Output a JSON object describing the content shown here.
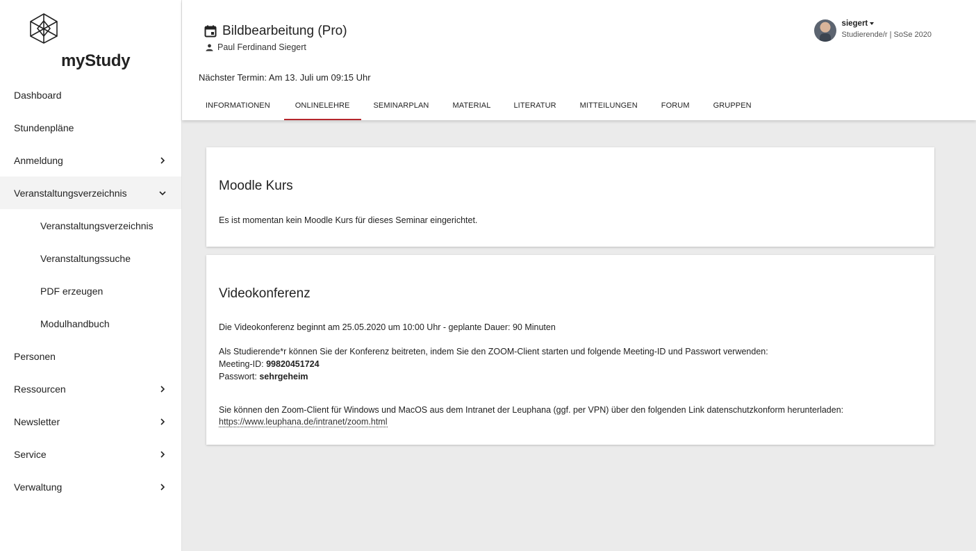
{
  "logo": {
    "text": "myStudy"
  },
  "sidebar": {
    "items": [
      {
        "label": "Dashboard",
        "chevron": ""
      },
      {
        "label": "Stundenpläne",
        "chevron": ""
      },
      {
        "label": "Anmeldung",
        "chevron": "right"
      },
      {
        "label": "Veranstaltungsverzeichnis",
        "chevron": "down"
      },
      {
        "label": "Veranstaltungsverzeichnis",
        "chevron": "",
        "sub": true
      },
      {
        "label": "Veranstaltungssuche",
        "chevron": "",
        "sub": true
      },
      {
        "label": "PDF erzeugen",
        "chevron": "",
        "sub": true
      },
      {
        "label": "Modulhandbuch",
        "chevron": "",
        "sub": true
      },
      {
        "label": "Personen",
        "chevron": ""
      },
      {
        "label": "Ressourcen",
        "chevron": "right"
      },
      {
        "label": "Newsletter",
        "chevron": "right"
      },
      {
        "label": "Service",
        "chevron": "right"
      },
      {
        "label": "Verwaltung",
        "chevron": "right"
      }
    ]
  },
  "header": {
    "title": "Bildbearbeitung (Pro)",
    "lecturer": "Paul Ferdinand Siegert",
    "next_date": "Nächster Termin: Am 13. Juli um 09:15 Uhr",
    "tabs": [
      "INFORMATIONEN",
      "ONLINELEHRE",
      "SEMINARPLAN",
      "MATERIAL",
      "LITERATUR",
      "MITTEILUNGEN",
      "FORUM",
      "GRUPPEN"
    ],
    "active_tab": "ONLINELEHRE"
  },
  "user": {
    "name": "siegert",
    "role": "Studierende/r | SoSe 2020"
  },
  "moodle": {
    "title": "Moodle Kurs",
    "text": "Es ist momentan kein Moodle Kurs für dieses Seminar eingerichtet."
  },
  "video": {
    "title": "Videokonferenz",
    "start_text": "Die Videokonferenz beginnt am 25.05.2020 um 10:00 Uhr - geplante Dauer: 90 Minuten",
    "join_text": "Als Studierende*r können Sie der Konferenz beitreten, indem Sie den ZOOM-Client starten und folgende Meeting-ID und Passwort verwenden:",
    "meeting_label": "Meeting-ID: ",
    "meeting_id": "99820451724",
    "password_label": "Passwort: ",
    "password": "sehrgeheim",
    "zoom_text": "Sie können den Zoom-Client für Windows und MacOS aus dem Intranet der Leuphana (ggf. per VPN) über den folgenden Link datenschutzkonform herunterladen:",
    "zoom_link": "https://www.leuphana.de/intranet/zoom.html"
  },
  "colors": {
    "accent": "#b5262c"
  }
}
